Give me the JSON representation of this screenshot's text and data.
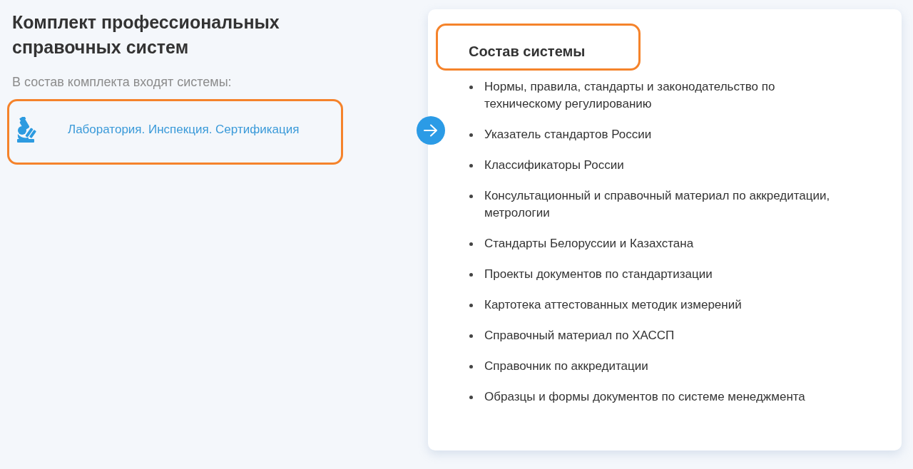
{
  "kit": {
    "title": "Комплект профессиональных справочных систем",
    "subtitle": "В состав комплекта входят системы:",
    "systems": [
      {
        "label": "Лаборатория. Инспекция. Сертификация",
        "highlighted": true
      }
    ]
  },
  "composition": {
    "title": "Состав системы",
    "title_highlighted": true,
    "items": [
      "Нормы, правила, стандарты и законодательство по техническому регулированию",
      "Указатель стандартов России",
      "Классификаторы России",
      "Консультационный и справочный материал по аккредитации, метрологии",
      "Стандарты Белоруссии и Казахстана",
      "Проекты документов по стандартизации",
      "Картотека аттестованных методик измерений",
      "Справочный материал по ХАССП",
      "Справочник по аккредитации",
      "Образцы и формы документов по системе менеджмента"
    ]
  }
}
